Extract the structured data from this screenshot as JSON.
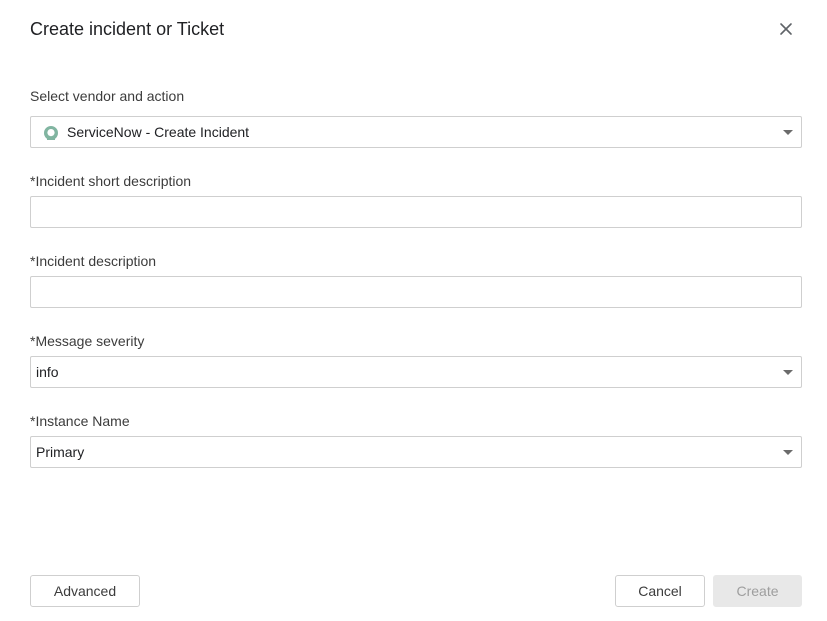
{
  "dialog": {
    "title": "Create incident or Ticket"
  },
  "fields": {
    "vendor": {
      "label": "Select vendor and action",
      "value": "ServiceNow - Create Incident",
      "icon": "servicenow-icon"
    },
    "short_description": {
      "label": "*Incident short description",
      "value": ""
    },
    "description": {
      "label": "*Incident description",
      "value": ""
    },
    "severity": {
      "label": "*Message severity",
      "value": "info"
    },
    "instance": {
      "label": "*Instance Name",
      "value": "Primary"
    }
  },
  "buttons": {
    "advanced": "Advanced",
    "cancel": "Cancel",
    "create": "Create"
  },
  "colors": {
    "servicenow_icon": "#81b5a1",
    "border": "#cfcfcf",
    "disabled_bg": "#e8e8e8",
    "disabled_text": "#9e9e9e"
  }
}
